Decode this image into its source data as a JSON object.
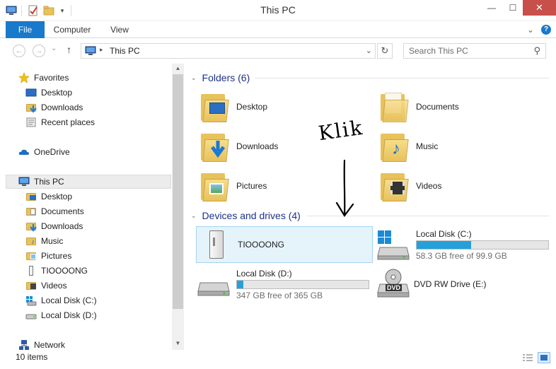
{
  "window": {
    "title": "This PC",
    "min_label": "—",
    "max_label": "☐",
    "close_label": "✕"
  },
  "ribbon": {
    "tabs": [
      "File",
      "Computer",
      "View"
    ],
    "expand_glyph": "⌄",
    "help_glyph": "?"
  },
  "address": {
    "back_glyph": "←",
    "forward_glyph": "→",
    "recent_glyph": "⌄",
    "up_glyph": "↑",
    "sep_glyph": "▸",
    "path": "This PC",
    "dropdown_glyph": "⌄",
    "refresh_glyph": "↻",
    "search_placeholder": "Search This PC",
    "search_glyph": "⚲"
  },
  "nav": {
    "favorites": {
      "label": "Favorites",
      "items": [
        "Desktop",
        "Downloads",
        "Recent places"
      ]
    },
    "onedrive": "OneDrive",
    "thispc": {
      "label": "This PC",
      "items": [
        "Desktop",
        "Documents",
        "Downloads",
        "Music",
        "Pictures",
        "TIOOOONG",
        "Videos",
        "Local Disk (C:)",
        "Local Disk (D:)"
      ]
    },
    "network": "Network",
    "scroll_up": "▲",
    "scroll_down": "▼"
  },
  "content": {
    "folders_header": "Folders (6)",
    "folders": [
      "Desktop",
      "Documents",
      "Downloads",
      "Music",
      "Pictures",
      "Videos"
    ],
    "devices_header": "Devices and drives (4)",
    "devices": [
      {
        "name": "TIOOOONG"
      },
      {
        "name": "Local Disk (C:)",
        "free": "58.3 GB free of 99.9 GB",
        "used_fraction": 0.416
      },
      {
        "name": "Local Disk (D:)",
        "free": "347 GB free of 365 GB",
        "used_fraction": 0.05
      },
      {
        "name": "DVD RW Drive (E:)",
        "badge": "DVD"
      }
    ],
    "chevron": "⌄"
  },
  "annotation": {
    "text": "Klik"
  },
  "status": {
    "count": "10 items"
  },
  "colors": {
    "accent": "#1979ca",
    "header_text": "#1e3287",
    "drive_bar": "#26a0da",
    "selection_bg": "#e5f3fb"
  }
}
